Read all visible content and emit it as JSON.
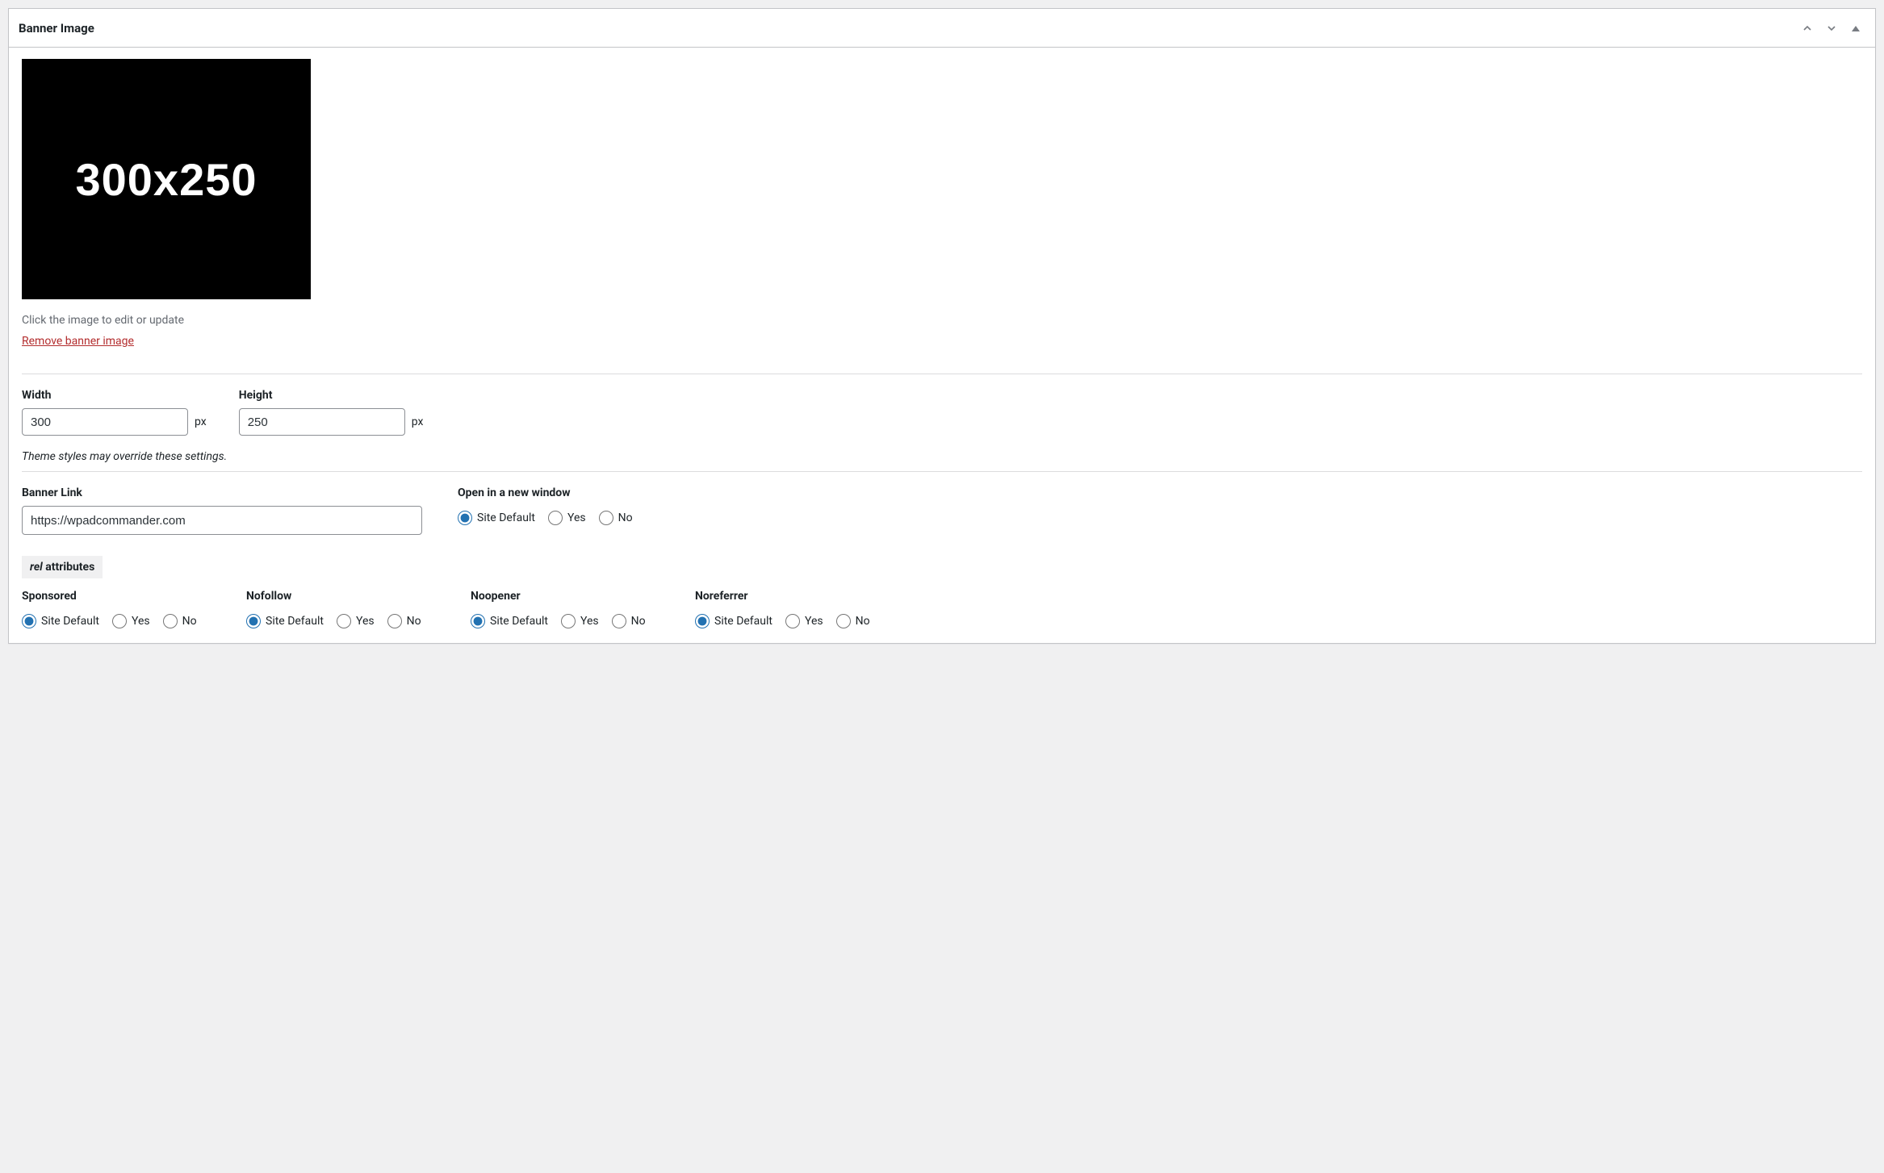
{
  "panel": {
    "title": "Banner Image"
  },
  "preview": {
    "placeholder_text": "300x250",
    "hint": "Click the image to edit or update",
    "remove_label": "Remove banner image"
  },
  "dimensions": {
    "width_label": "Width",
    "width_value": "300",
    "height_label": "Height",
    "height_value": "250",
    "unit": "px",
    "note": "Theme styles may override these settings."
  },
  "link": {
    "label": "Banner Link",
    "value": "https://wpadcommander.com"
  },
  "new_window": {
    "label": "Open in a new window",
    "options": {
      "default": "Site Default",
      "yes": "Yes",
      "no": "No"
    }
  },
  "rel": {
    "badge_prefix": "rel",
    "badge_word": "attributes",
    "groups": {
      "sponsored": {
        "label": "Sponsored",
        "options": {
          "default": "Site Default",
          "yes": "Yes",
          "no": "No"
        }
      },
      "nofollow": {
        "label": "Nofollow",
        "options": {
          "default": "Site Default",
          "yes": "Yes",
          "no": "No"
        }
      },
      "noopener": {
        "label": "Noopener",
        "options": {
          "default": "Site Default",
          "yes": "Yes",
          "no": "No"
        }
      },
      "noreferrer": {
        "label": "Noreferrer",
        "options": {
          "default": "Site Default",
          "yes": "Yes",
          "no": "No"
        }
      }
    }
  }
}
